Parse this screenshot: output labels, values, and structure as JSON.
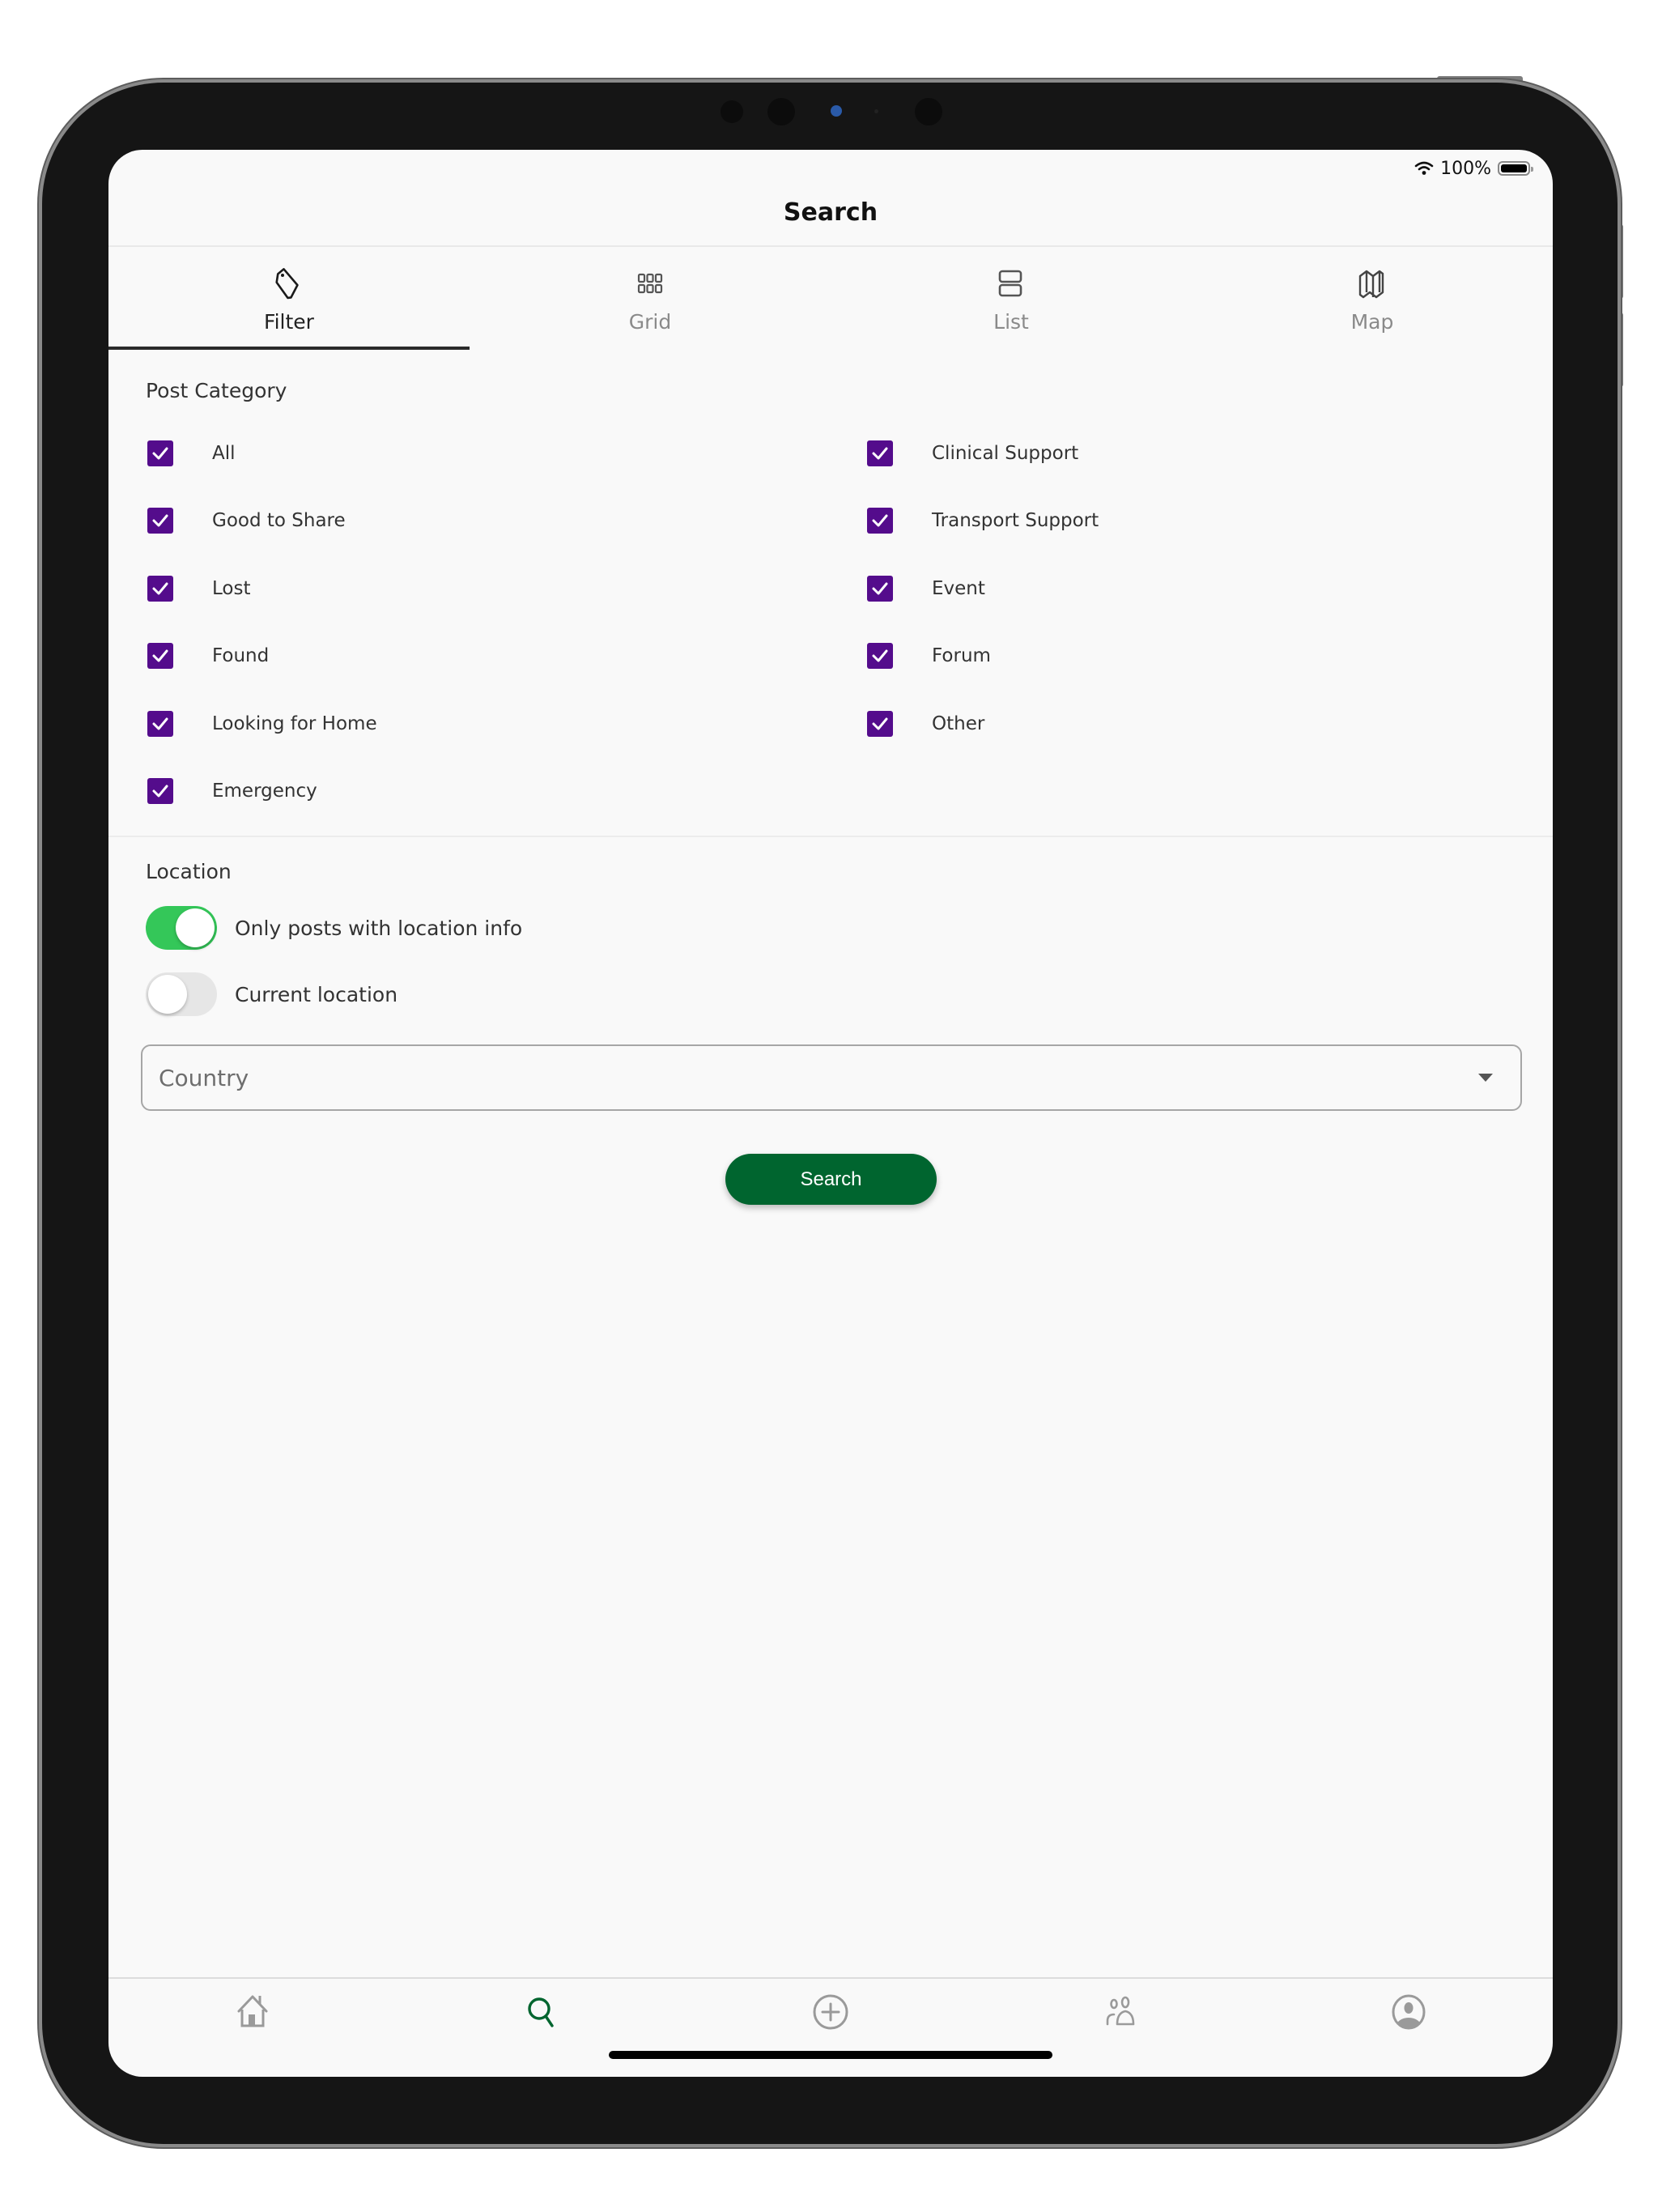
{
  "status_bar": {
    "battery_percent": "100%",
    "wifi_icon": "wifi-icon",
    "battery_icon": "battery-icon"
  },
  "header": {
    "title": "Search"
  },
  "tabs": [
    {
      "label": "Filter",
      "icon": "tag-icon",
      "active": true
    },
    {
      "label": "Grid",
      "icon": "grid-icon",
      "active": false
    },
    {
      "label": "List",
      "icon": "list-icon",
      "active": false
    },
    {
      "label": "Map",
      "icon": "map-icon",
      "active": false
    }
  ],
  "post_category": {
    "label": "Post Category",
    "left": [
      {
        "label": "All",
        "checked": true
      },
      {
        "label": "Good to Share",
        "checked": true
      },
      {
        "label": "Lost",
        "checked": true
      },
      {
        "label": "Found",
        "checked": true
      },
      {
        "label": "Looking for Home",
        "checked": true
      },
      {
        "label": "Emergency",
        "checked": true
      }
    ],
    "right": [
      {
        "label": "Clinical Support",
        "checked": true
      },
      {
        "label": "Transport Support",
        "checked": true
      },
      {
        "label": "Event",
        "checked": true
      },
      {
        "label": "Forum",
        "checked": true
      },
      {
        "label": "Other",
        "checked": true
      }
    ]
  },
  "location": {
    "label": "Location",
    "toggles": [
      {
        "label": "Only posts with location info",
        "on": true
      },
      {
        "label": "Current location",
        "on": false
      }
    ],
    "country_select": {
      "placeholder": "Country",
      "value": ""
    }
  },
  "search_button": {
    "label": "Search"
  },
  "bottom_nav": [
    {
      "icon": "home-icon",
      "active": false
    },
    {
      "icon": "search-icon",
      "active": true
    },
    {
      "icon": "add-circle-icon",
      "active": false
    },
    {
      "icon": "people-icon",
      "active": false
    },
    {
      "icon": "profile-icon",
      "active": false
    }
  ],
  "colors": {
    "checkbox": "#540c8c",
    "toggle_on": "#34c759",
    "primary_button": "#00652f",
    "nav_active": "#00652f",
    "nav_inactive": "#9a9a9a"
  }
}
